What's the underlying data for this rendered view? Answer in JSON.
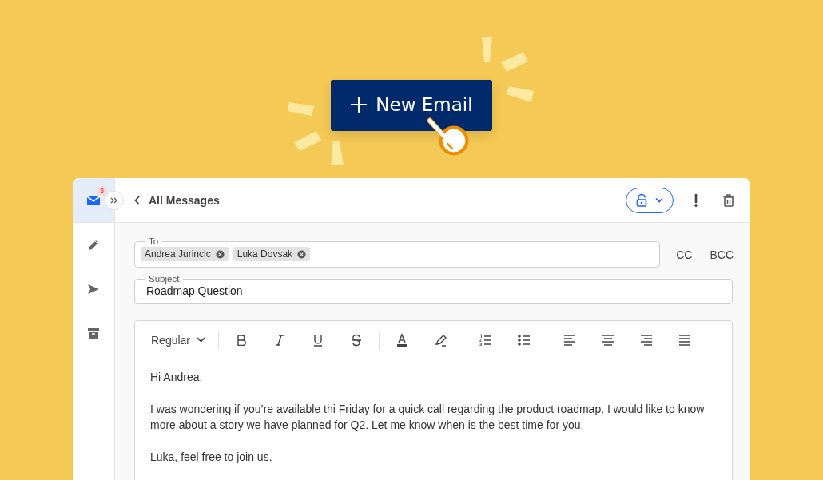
{
  "new_email_button": {
    "label": "New Email"
  },
  "sidebar": {
    "items": [
      {
        "kind": "mail",
        "selected": true,
        "badge": "3"
      },
      {
        "kind": "compose",
        "selected": false
      },
      {
        "kind": "send",
        "selected": false
      },
      {
        "kind": "archive",
        "selected": false
      }
    ]
  },
  "header": {
    "back_link": "All Messages"
  },
  "to_field": {
    "label": "To",
    "recipients": [
      "Andrea Jurincic",
      "Luka Dovsak"
    ]
  },
  "cc_button": "CC",
  "bcc_button": "BCC",
  "subject_field": {
    "label": "Subject",
    "value": "Roadmap Question"
  },
  "editor": {
    "format_dropdown": "Regular",
    "toolbar_groups": [
      {
        "tools": [
          {
            "kind": "bold"
          },
          {
            "kind": "italic"
          },
          {
            "kind": "underline"
          },
          {
            "kind": "strikethrough"
          }
        ]
      },
      {
        "tools": [
          {
            "kind": "text-color"
          },
          {
            "kind": "highlight"
          }
        ]
      },
      {
        "tools": [
          {
            "kind": "ordered-list"
          },
          {
            "kind": "bullet-list"
          }
        ]
      },
      {
        "tools": [
          {
            "kind": "align-left"
          },
          {
            "kind": "align-center"
          },
          {
            "kind": "align-right"
          },
          {
            "kind": "justify"
          }
        ]
      }
    ],
    "paragraphs": [
      "Hi Andrea,",
      "I was wondering if you’re available thi Friday for a quick call regarding the product roadmap. I would like to know more about a story we have planned for Q2. Let me know when is the best time for you.",
      "Luka, feel free to join us."
    ]
  }
}
